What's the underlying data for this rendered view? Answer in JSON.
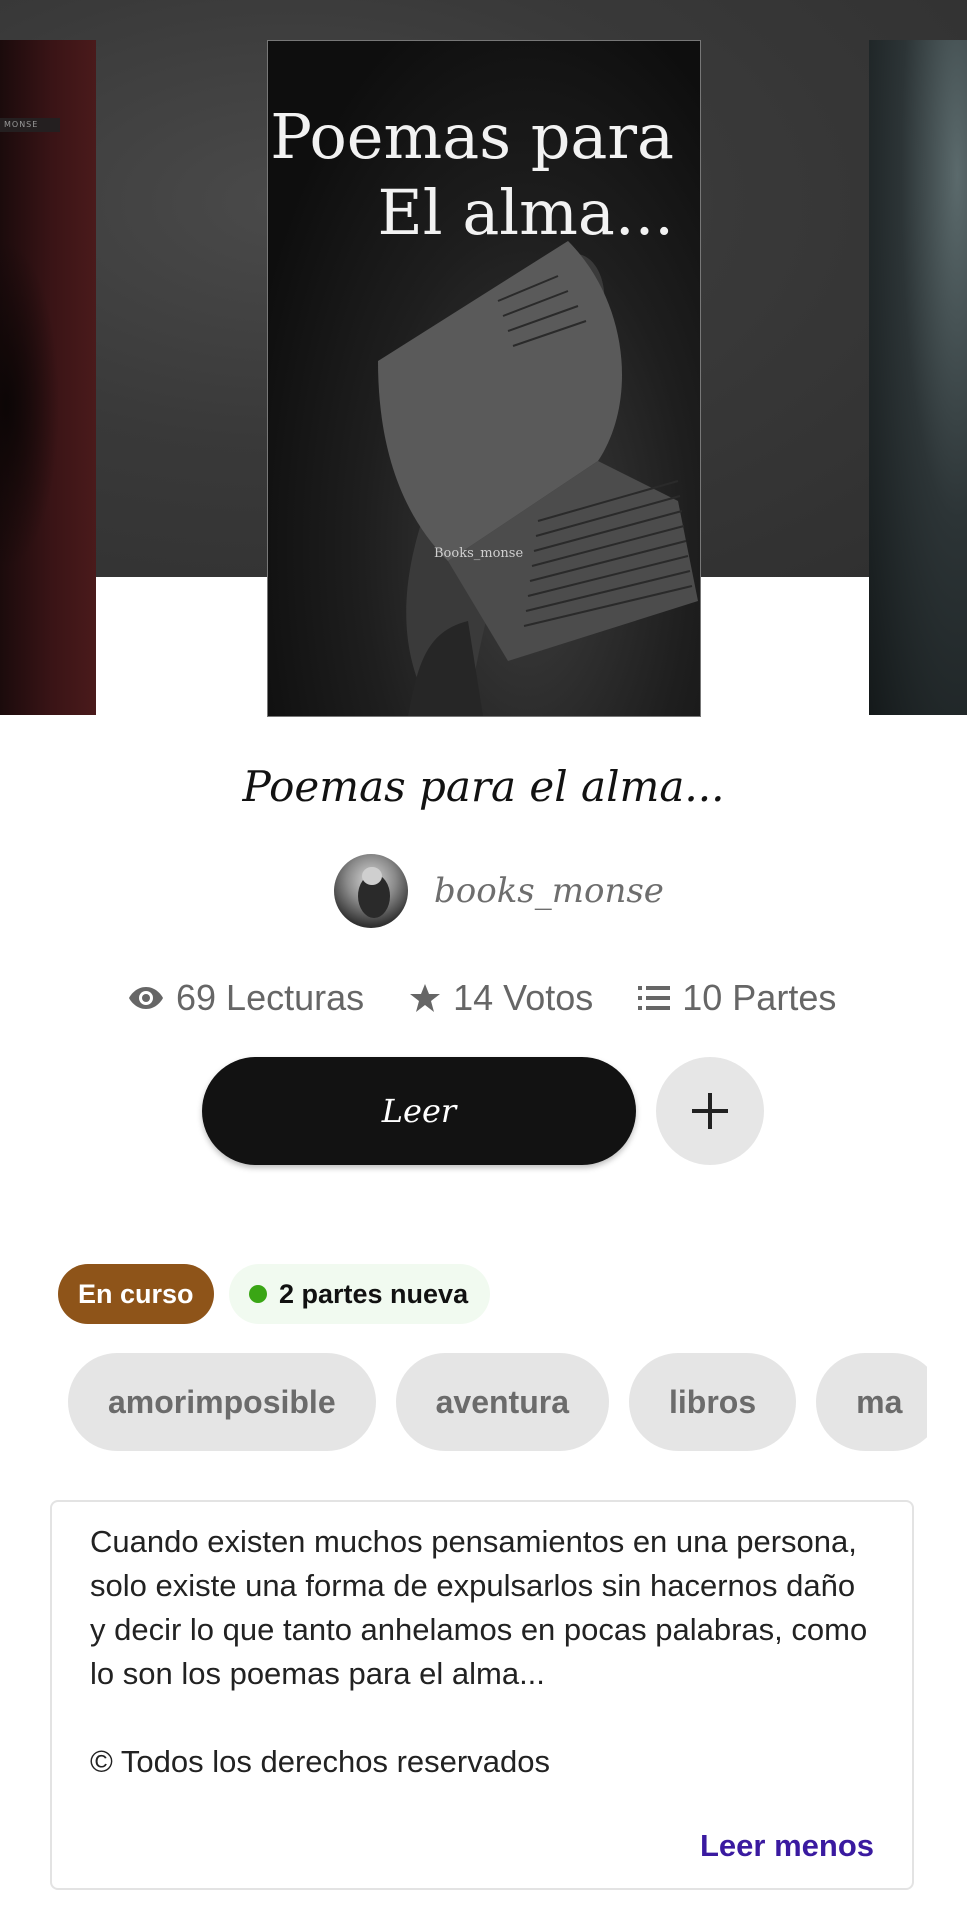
{
  "covers": {
    "main": {
      "title_line1": "Poemas para",
      "title_line2": "El alma...",
      "author_mark": "Books_monse"
    },
    "left": {
      "strip_text": "MONSE"
    }
  },
  "story": {
    "title": "Poemas para el alma..."
  },
  "author": {
    "name": "books_monse"
  },
  "stats": {
    "reads": "69 Lecturas",
    "votes": "14 Votos",
    "parts": "10 Partes"
  },
  "actions": {
    "read_label": "Leer",
    "add_label": "+"
  },
  "status": {
    "label": "En curso",
    "new_parts": "2 partes nueva",
    "status_color": "#8e5419",
    "new_dot_color": "#3aa615"
  },
  "tags": [
    "amorimposible",
    "aventura",
    "libros",
    "ma"
  ],
  "description": {
    "text": "Cuando existen muchos pensamientos en una persona, solo existe una forma de expulsarlos sin hacernos daño y decir lo que tanto anhelamos en pocas palabras, como lo son los poemas para el alma...",
    "copyright": "© Todos los derechos reservados",
    "toggle_label": "Leer menos",
    "toggle_color": "#3a1aa0"
  },
  "icons": {
    "reads": "eye-icon",
    "votes": "star-icon",
    "parts": "list-icon",
    "add": "plus-icon"
  }
}
